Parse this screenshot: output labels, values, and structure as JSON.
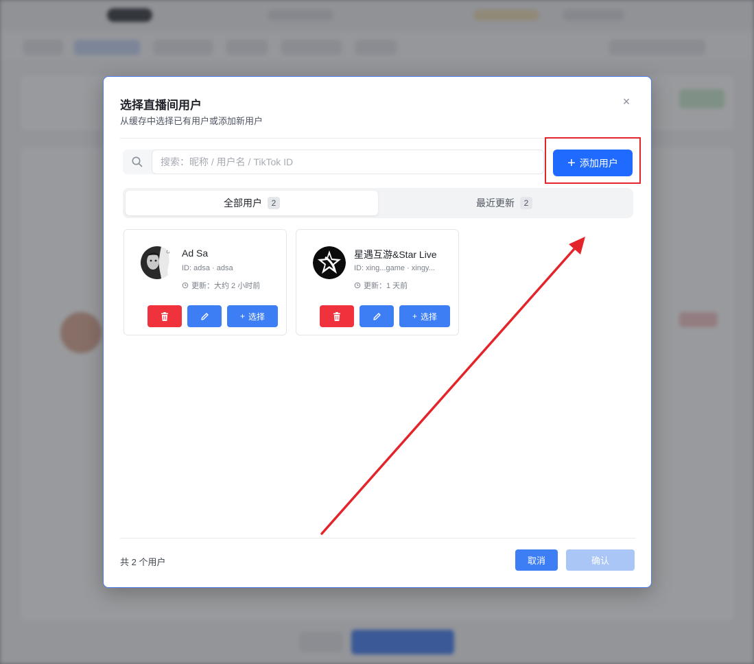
{
  "modal": {
    "title": "选择直播间用户",
    "subtitle": "从缓存中选择已有用户或添加新用户",
    "close_label": "×"
  },
  "search": {
    "placeholder": "搜索：昵称 / 用户名 / TikTok ID",
    "value": ""
  },
  "add_user_button": {
    "label": "添加用户"
  },
  "tabs": [
    {
      "label": "全部用户",
      "count": "2",
      "active": true
    },
    {
      "label": "最近更新",
      "count": "2",
      "active": false
    }
  ],
  "users": [
    {
      "name": "Ad Sa",
      "id_line": "ID: adsa · adsa",
      "updated": "更新：大约 2 小时前",
      "select_label": "选择"
    },
    {
      "name": "星遇互游&Star Live",
      "id_line": "ID: xing...game · xingy...",
      "updated": "更新：1 天前",
      "select_label": "选择"
    }
  ],
  "footer": {
    "count_text": "共 2 个用户",
    "cancel_label": "取消",
    "confirm_label": "确认"
  },
  "colors": {
    "primary": "#1f6bff",
    "danger": "#f0323c",
    "annotation": "#e3242b",
    "confirm_disabled": "#a9c6f7"
  },
  "icons": {
    "search": "search-icon",
    "close": "close-icon",
    "plus": "plus-icon",
    "delete": "trash-icon",
    "edit": "pencil-icon",
    "clock": "clock-icon"
  }
}
